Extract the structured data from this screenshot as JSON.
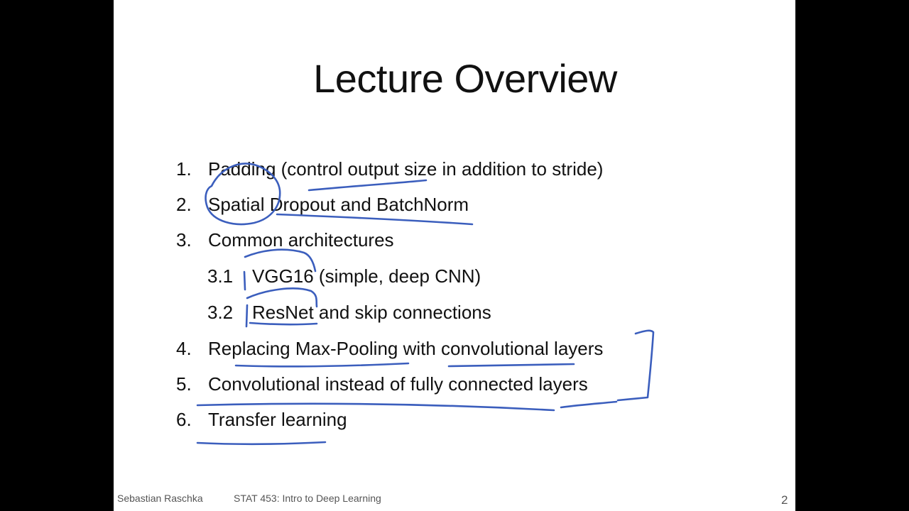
{
  "slide": {
    "title": "Lecture Overview",
    "items": [
      {
        "number": "1.",
        "text": "Padding (control output size in addition to stride)"
      },
      {
        "number": "2.",
        "text": "Spatial Dropout and BatchNorm"
      },
      {
        "number": "3.",
        "text": "Common architectures"
      },
      {
        "number": "3.1",
        "text": "VGG16 (simple, deep CNN)"
      },
      {
        "number": "3.2",
        "text": "ResNet and skip connections"
      },
      {
        "number": "4.",
        "text": "Replacing Max-Pooling with convolutional layers"
      },
      {
        "number": "5.",
        "text": "Convolutional instead of fully connected layers"
      },
      {
        "number": "6.",
        "text": "Transfer learning"
      }
    ],
    "footer": {
      "author": "Sebastian Raschka",
      "course": "STAT 453: Intro to Deep Learning",
      "page_number": "2"
    }
  },
  "colors": {
    "background": "#000000",
    "slide": "#ffffff",
    "text": "#111111",
    "footer_text": "#555555",
    "annotation_ink": "#3b5ebd"
  }
}
